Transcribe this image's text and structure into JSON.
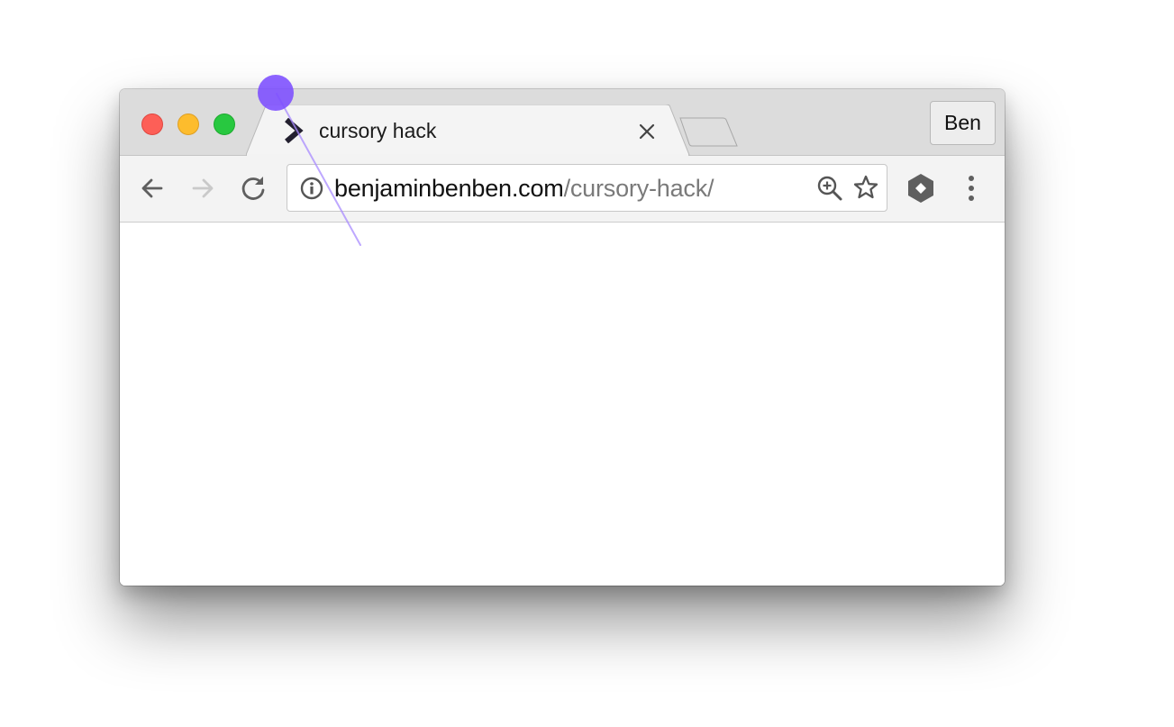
{
  "window": {
    "controls": {
      "close": "close-window",
      "minimize": "minimize-window",
      "zoom": "zoom-window"
    },
    "tab": {
      "title": "cursory hack",
      "favicon": "chevron-right-icon",
      "close_glyph": "×"
    },
    "profile": {
      "label": "Ben"
    }
  },
  "toolbar": {
    "back": "arrow-left-icon",
    "forward": "arrow-right-icon",
    "reload": "reload-icon",
    "address": {
      "host": "benjaminbenben.com",
      "path": "/cursory-hack/"
    },
    "actions": [
      "zoom-in-icon",
      "star-icon",
      "extension-icon",
      "more-vertical-icon"
    ]
  },
  "colors": {
    "cursor": "#7c4dff",
    "close": "#fd5f57",
    "minimize": "#fdbc2d",
    "zoom": "#28c840"
  }
}
